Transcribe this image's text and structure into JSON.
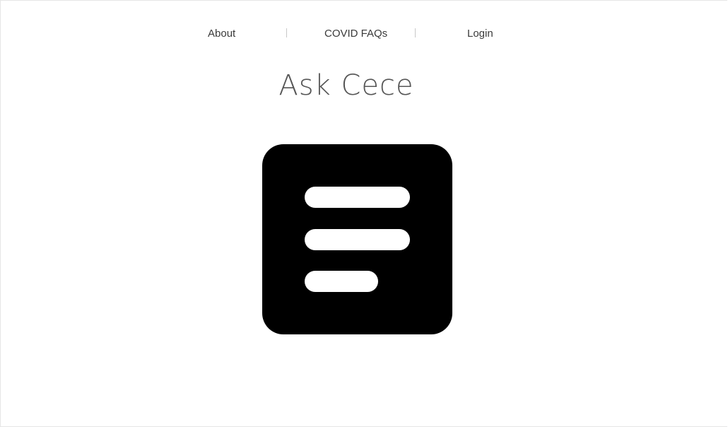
{
  "nav": {
    "items": [
      {
        "label": "About"
      },
      {
        "label": "COVID FAQs"
      },
      {
        "label": "Login"
      }
    ]
  },
  "header": {
    "title": "Ask Cece"
  },
  "main": {
    "logo_icon": "document-lines-icon",
    "logo_color": "#000000"
  }
}
